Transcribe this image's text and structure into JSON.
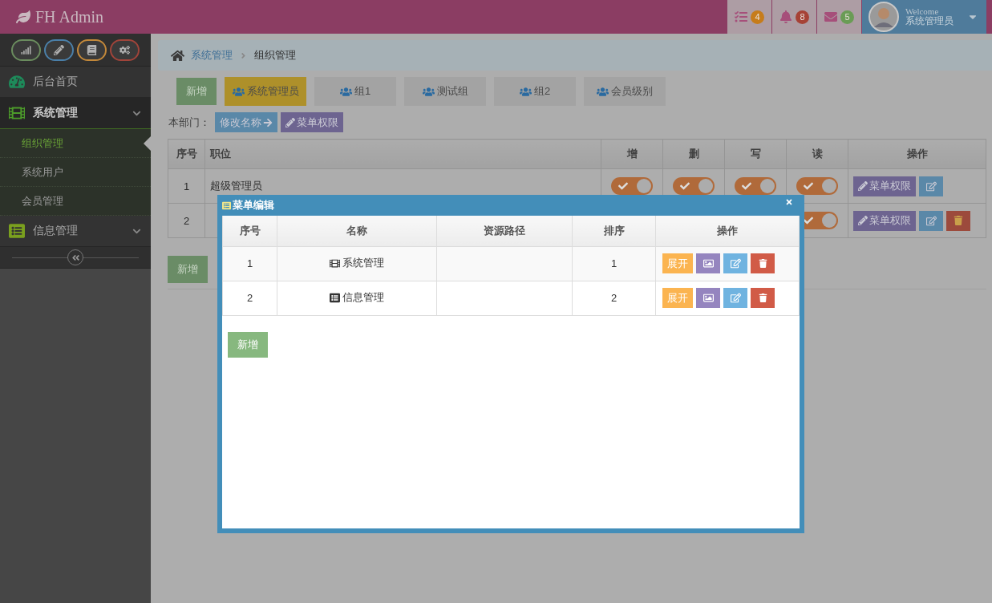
{
  "header": {
    "brand": "FH Admin",
    "notifications": [
      {
        "kind": "tasks",
        "count": "4",
        "color": "#c67c1b"
      },
      {
        "kind": "bell",
        "count": "8",
        "color": "#a64236"
      },
      {
        "kind": "mail",
        "count": "5",
        "color": "#6a9c55"
      }
    ],
    "user": {
      "greeting": "Welcome",
      "name": "系统管理员"
    }
  },
  "sidebar": {
    "shortcuts": [
      {
        "kind": "signal",
        "color": "#6a8c5e"
      },
      {
        "kind": "pencil",
        "color": "#4a7fa8"
      },
      {
        "kind": "book",
        "color": "#c2883a"
      },
      {
        "kind": "cogs",
        "color": "#a0443a"
      }
    ],
    "items": [
      {
        "kind": "dashboard",
        "label": "后台首页",
        "expanded": false
      },
      {
        "kind": "film",
        "label": "系统管理",
        "expanded": true,
        "children": [
          {
            "label": "组织管理",
            "selected": true
          },
          {
            "label": "系统用户",
            "selected": false
          },
          {
            "label": "会员管理",
            "selected": false
          }
        ]
      },
      {
        "kind": "list",
        "label": "信息管理",
        "expanded": false
      }
    ]
  },
  "breadcrumb": [
    "系统管理",
    "组织管理"
  ],
  "toolbar": {
    "add": "新增",
    "tabs": [
      {
        "label": "系统管理员",
        "selected": true
      },
      {
        "label": "组1",
        "selected": false
      },
      {
        "label": "测试组",
        "selected": false
      },
      {
        "label": "组2",
        "selected": false
      },
      {
        "label": "会员级别",
        "selected": false
      }
    ]
  },
  "department": {
    "label": "本部门：",
    "rename": "修改名称",
    "permissions": "菜单权限"
  },
  "roles_table": {
    "columns": [
      "序号",
      "职位",
      "增",
      "删",
      "写",
      "读",
      "操作"
    ],
    "rows": [
      {
        "no": "1",
        "position": "超级管理员",
        "toggles": [
          {
            "on": true
          },
          {
            "on": true
          },
          {
            "on": true
          },
          {
            "on": true
          }
        ],
        "actions": [
          {
            "kind": "permissions",
            "label": "菜单权限"
          },
          {
            "kind": "edit"
          }
        ]
      },
      {
        "no": "2",
        "toggles": [
          {
            "on": true
          }
        ],
        "actions": [
          {
            "kind": "permissions",
            "label": "菜单权限"
          },
          {
            "kind": "edit"
          },
          {
            "kind": "delete"
          }
        ]
      }
    ]
  },
  "add_button": "新增",
  "modal": {
    "title": "菜单编辑",
    "columns": [
      "序号",
      "名称",
      "资源路径",
      "排序",
      "操作"
    ],
    "rows": [
      {
        "no": "1",
        "kind": "film",
        "name": "系统管理",
        "order": "1",
        "actions": [
          {
            "kind": "expand",
            "label": "展开"
          },
          {
            "kind": "image"
          },
          {
            "kind": "edit"
          },
          {
            "kind": "delete"
          }
        ]
      },
      {
        "no": "2",
        "kind": "list",
        "name": "信息管理",
        "order": "2",
        "actions": [
          {
            "kind": "expand",
            "label": "展开"
          },
          {
            "kind": "image"
          },
          {
            "kind": "edit"
          },
          {
            "kind": "delete"
          }
        ]
      }
    ],
    "add": "新增"
  }
}
